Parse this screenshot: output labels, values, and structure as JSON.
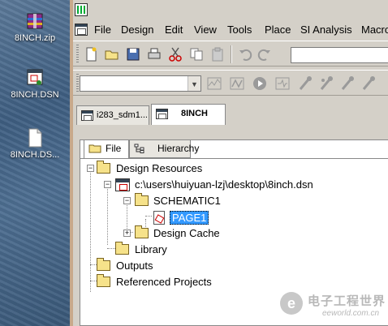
{
  "desktop": {
    "icons": [
      {
        "label": "8INCH.zip",
        "icon": "archive-icon"
      },
      {
        "label": "8INCH.DSN",
        "icon": "dsn-file-icon"
      },
      {
        "label": "8INCH.DS...",
        "icon": "file-icon"
      }
    ]
  },
  "menubar": {
    "items": [
      "File",
      "Design",
      "Edit",
      "View",
      "Tools",
      "Place",
      "SI Analysis",
      "Macro"
    ]
  },
  "toolbar": {
    "buttons": [
      "new-icon",
      "open-icon",
      "save-icon",
      "print-icon",
      "cut-icon",
      "copy-icon",
      "paste-icon",
      "undo-icon",
      "redo-icon"
    ],
    "search_value": ""
  },
  "toolbar2": {
    "combo_value": "",
    "buttons": [
      "waveform-icon",
      "analyze-icon",
      "run-icon",
      "probe-icon",
      "marker-voltage-icon",
      "marker-current-icon",
      "marker-power-icon",
      "marker-diff-icon"
    ]
  },
  "doc_tabs": [
    {
      "label": "i283_sdm1...",
      "active": false
    },
    {
      "label": "8INCH",
      "active": true
    }
  ],
  "panel": {
    "tabs": [
      {
        "label": "File",
        "active": true
      },
      {
        "label": "Hierarchy",
        "active": false
      }
    ],
    "tree": {
      "design_resources": "Design Resources",
      "dsn_path": "c:\\users\\huiyuan-lzj\\desktop\\8inch.dsn",
      "schematic": "SCHEMATIC1",
      "page": "PAGE1",
      "design_cache": "Design Cache",
      "library": "Library",
      "outputs": "Outputs",
      "referenced_projects": "Referenced Projects"
    }
  },
  "watermark": {
    "logo_letter": "e",
    "title": "电子工程世界",
    "subtitle": "eeworld.com.cn"
  }
}
